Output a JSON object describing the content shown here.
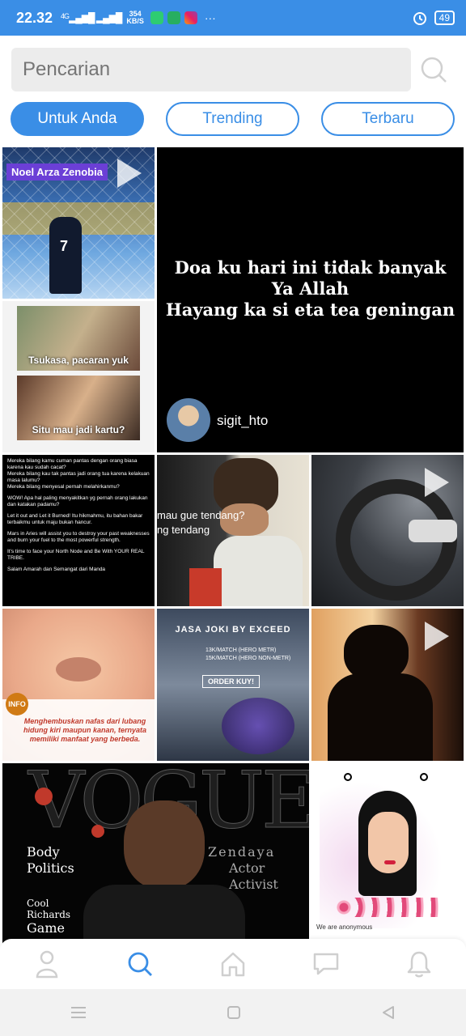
{
  "status": {
    "time": "22.32",
    "network": "4G",
    "speed_value": "354",
    "speed_unit": "KB/S",
    "dots": "···",
    "battery": "49"
  },
  "search": {
    "placeholder": "Pencarian"
  },
  "tabs": [
    {
      "label": "Untuk Anda",
      "active": true
    },
    {
      "label": "Trending",
      "active": false
    },
    {
      "label": "Terbaru",
      "active": false
    }
  ],
  "posts": {
    "noel": {
      "caption": "Noel Arza Zenobia",
      "jersey": "7"
    },
    "doa": {
      "line1": "Doa ku hari ini tidak banyak",
      "line2": "Ya Allah",
      "line3": "Hayang ka si eta tea geningan",
      "username": "sigit_hto"
    },
    "meme": {
      "top": "Tsukasa, pacaran yuk",
      "bottom": "Situ mau jadi kartu?"
    },
    "textpost": {
      "p1": "Mereka bilang kamu cuman pantas dengan orang biasa karena kau sudah cacat?",
      "p2": "Mereka bilang kau tak pantas jadi orang tua karena kelakuan masa lalumu?",
      "p3": "Mereka bilang menyesal pernah melahirkanmu?",
      "p4": "WOW! Apa hal paling menyakitkan yg pernah orang lakukan dan katakan padamu?",
      "p5": "Let it out and Let it Burned! Itu hikmahmu, itu bahan bakar terbaikmu untuk maju bukan hancur.",
      "p6": "Mars in Aries will assist you to destroy your past weaknesses and burn your fuel to the most powerful strength.",
      "p7": "It's time to face your North Node and Be With YOUR REAL TRIBE.",
      "p8": "Salam Amarah dan Semangat dari Manda"
    },
    "tendang": {
      "line1": "mau gue tendang?",
      "line2": "ng tendang"
    },
    "nose": {
      "badge": "INFO",
      "text": "Menghembuskan nafas dari lubang hidung kiri maupun kanan, ternyata memiliki manfaat yang berbeda."
    },
    "joki": {
      "title": "JASA JOKI BY EXCEED",
      "rate1": "13K/MATCH (HERO METR)",
      "rate2": "15K/MATCH (HERO NON-METR)",
      "order": "ORDER KUY!"
    },
    "vogue": {
      "mast": "VOGUE",
      "left1": "Body",
      "left2": "Politics",
      "left3": "Cool",
      "left4": "Richards",
      "left5": "Game",
      "right1": "Zendaya",
      "right2": "Actor",
      "right3": "Activist"
    },
    "anon": {
      "caption": "We are anonymous"
    }
  },
  "colors": {
    "accent": "#3a8ee6"
  }
}
